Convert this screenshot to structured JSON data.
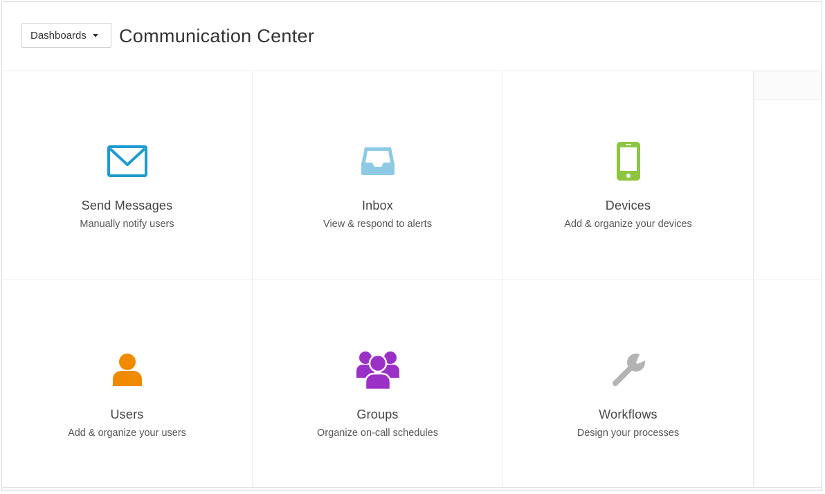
{
  "header": {
    "dashboards_label": "Dashboards",
    "title": "Communication Center"
  },
  "tiles": [
    {
      "title": "Send Messages",
      "subtitle": "Manually notify users",
      "icon": "envelope-icon",
      "color": "#1e9bd0"
    },
    {
      "title": "Inbox",
      "subtitle": "View & respond to alerts",
      "icon": "inbox-tray-icon",
      "color": "#8ecae6"
    },
    {
      "title": "Devices",
      "subtitle": "Add & organize your devices",
      "icon": "mobile-phone-icon",
      "color": "#8cc63f"
    },
    {
      "title": "Users",
      "subtitle": "Add & organize your users",
      "icon": "user-icon",
      "color": "#f08a00"
    },
    {
      "title": "Groups",
      "subtitle": "Organize on-call schedules",
      "icon": "group-icon",
      "color": "#9b30c7"
    },
    {
      "title": "Workflows",
      "subtitle": "Design your processes",
      "icon": "wrench-icon",
      "color": "#b3b3b3"
    }
  ]
}
